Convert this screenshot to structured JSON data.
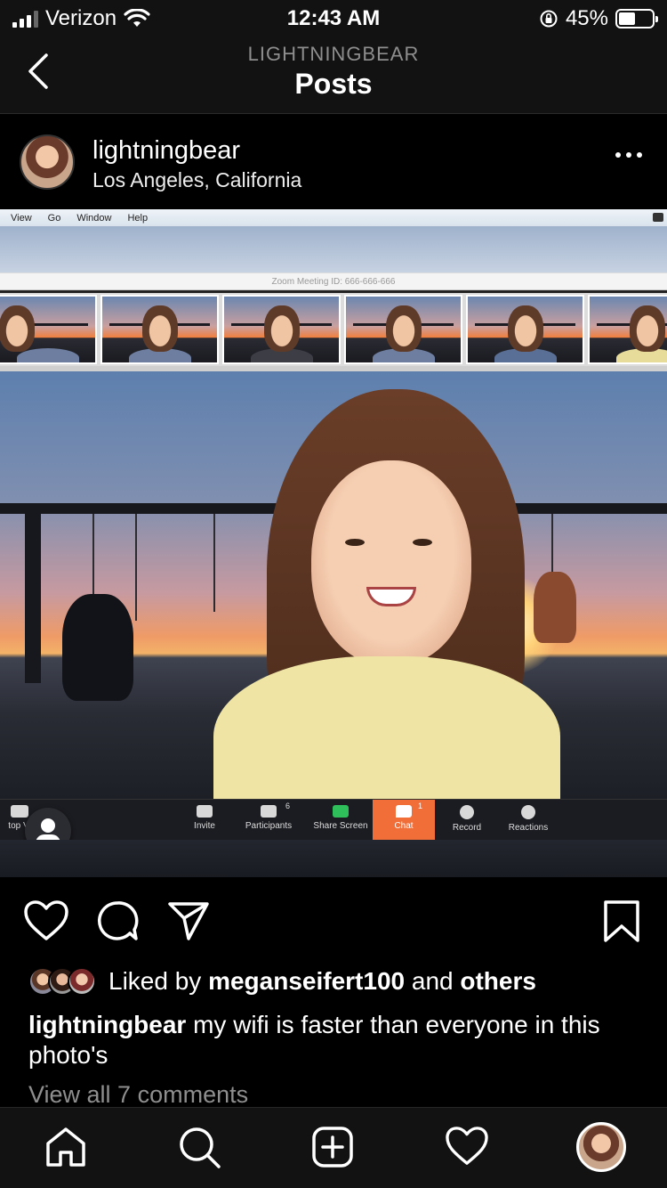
{
  "status_bar": {
    "carrier": "Verizon",
    "time": "12:43 AM",
    "battery": "45%"
  },
  "nav": {
    "subtitle": "LIGHTNINGBEAR",
    "title": "Posts"
  },
  "post": {
    "username": "lightningbear",
    "location": "Los Angeles, California",
    "likes_prefix": "Liked by",
    "liked_by": "meganseifert100",
    "likes_and": "and",
    "likes_others": "others",
    "caption_user": "lightningbear",
    "caption_text": "my wifi is faster than everyone in this photo's",
    "comments_link": "View all 7 comments"
  },
  "zoom": {
    "menu": [
      "View",
      "Go",
      "Window",
      "Help"
    ],
    "meeting_id": "Zoom Meeting ID: 666-666-666",
    "toolbar": {
      "stop_video": "top Vi",
      "invite": "Invite",
      "participants": "Participants",
      "participants_count": "6",
      "share_screen": "Share Screen",
      "chat": "Chat",
      "chat_badge": "1",
      "record": "Record",
      "reactions": "Reactions"
    },
    "accent": "#f26e39"
  },
  "icons": {
    "back": "chevron-left-icon",
    "more": "more-dots-icon",
    "like": "heart-icon",
    "comment": "comment-bubble-icon",
    "share": "paper-plane-icon",
    "save": "bookmark-icon",
    "home": "home-icon",
    "search": "search-icon",
    "new_post": "add-post-icon",
    "activity": "heart-icon"
  }
}
